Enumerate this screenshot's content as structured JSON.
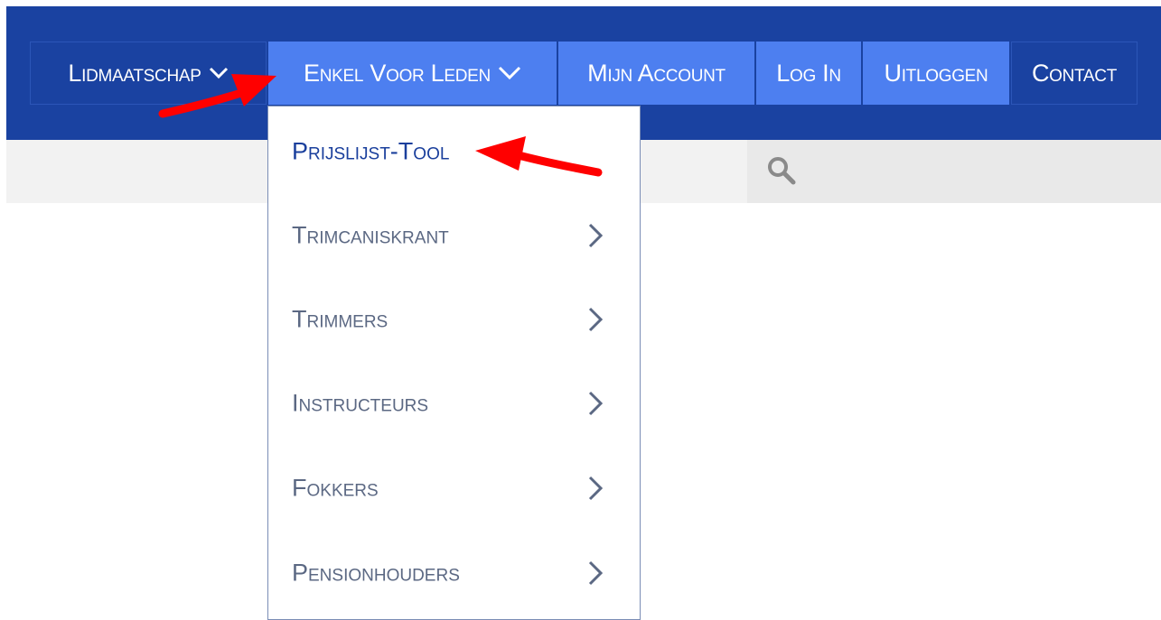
{
  "nav": {
    "items": [
      {
        "label": "Lidmaatschap",
        "chevron": true,
        "highlight": false
      },
      {
        "label": "Enkel Voor Leden",
        "chevron": true,
        "highlight": true
      },
      {
        "label": "Mijn Account",
        "chevron": false,
        "highlight": true
      },
      {
        "label": "Log In",
        "chevron": false,
        "highlight": true
      },
      {
        "label": "Uitloggen",
        "chevron": false,
        "highlight": true
      },
      {
        "label": "Contact",
        "chevron": false,
        "highlight": false
      }
    ]
  },
  "dropdown": {
    "items": [
      {
        "label": "Prijslijst-Tool",
        "has_submenu": false,
        "active": true
      },
      {
        "label": "Trimcaniskrant",
        "has_submenu": true,
        "active": false
      },
      {
        "label": "Trimmers",
        "has_submenu": true,
        "active": false
      },
      {
        "label": "Instructeurs",
        "has_submenu": true,
        "active": false
      },
      {
        "label": "Fokkers",
        "has_submenu": true,
        "active": false
      },
      {
        "label": "Pensionhouders",
        "has_submenu": true,
        "active": false
      }
    ]
  },
  "search": {
    "icon": "search-icon"
  },
  "annotations": {
    "arrow_color": "#ff0000",
    "arrows": [
      "arrow-to-enkel-voor-leden",
      "arrow-to-prijslijst-tool"
    ]
  },
  "colors": {
    "header_blue": "#1a42a1",
    "highlight_blue": "#4d7ff0",
    "menu_text": "#5b6883",
    "menu_active_text": "#1a3f9c"
  }
}
